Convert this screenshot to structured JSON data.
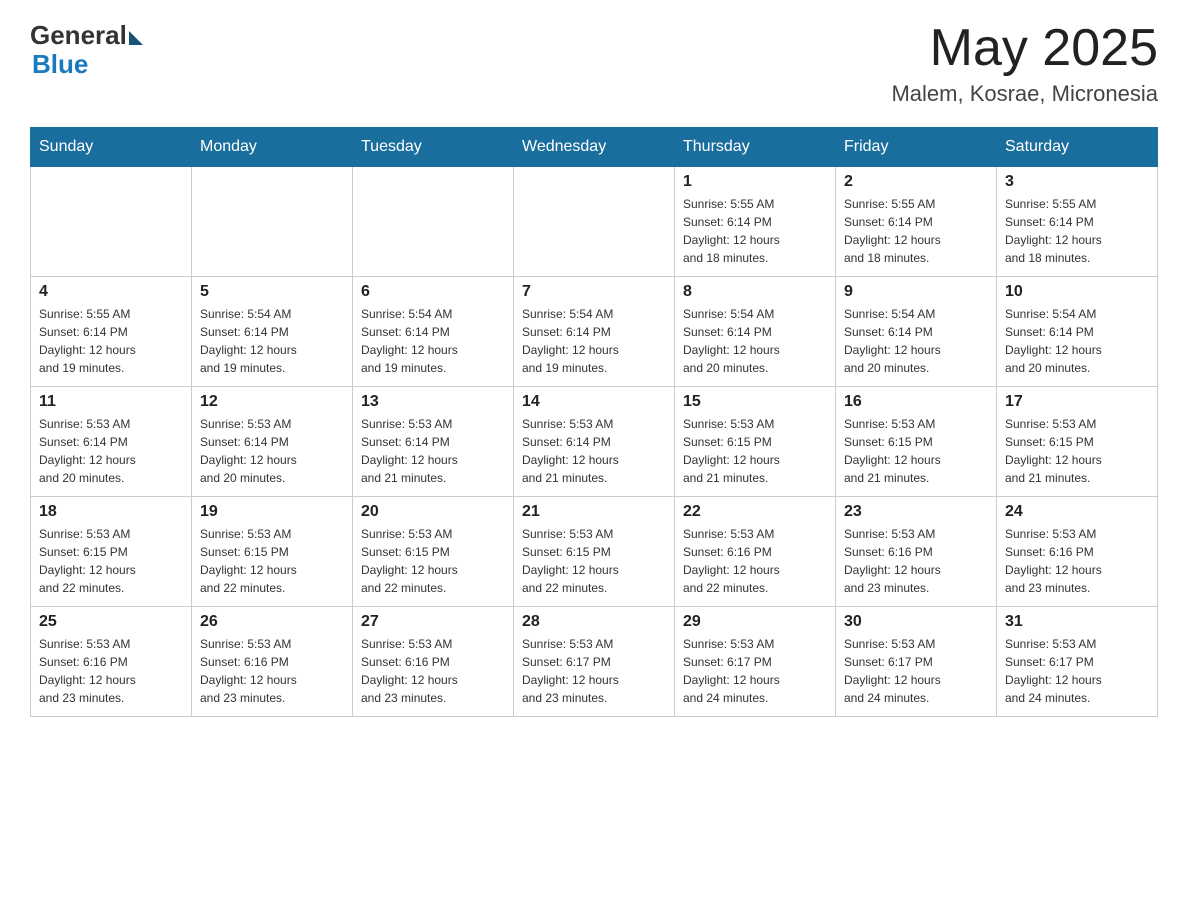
{
  "logo": {
    "text_general": "General",
    "text_blue": "Blue"
  },
  "header": {
    "month_year": "May 2025",
    "location": "Malem, Kosrae, Micronesia"
  },
  "days_of_week": [
    "Sunday",
    "Monday",
    "Tuesday",
    "Wednesday",
    "Thursday",
    "Friday",
    "Saturday"
  ],
  "weeks": [
    [
      {
        "day": "",
        "info": ""
      },
      {
        "day": "",
        "info": ""
      },
      {
        "day": "",
        "info": ""
      },
      {
        "day": "",
        "info": ""
      },
      {
        "day": "1",
        "info": "Sunrise: 5:55 AM\nSunset: 6:14 PM\nDaylight: 12 hours\nand 18 minutes."
      },
      {
        "day": "2",
        "info": "Sunrise: 5:55 AM\nSunset: 6:14 PM\nDaylight: 12 hours\nand 18 minutes."
      },
      {
        "day": "3",
        "info": "Sunrise: 5:55 AM\nSunset: 6:14 PM\nDaylight: 12 hours\nand 18 minutes."
      }
    ],
    [
      {
        "day": "4",
        "info": "Sunrise: 5:55 AM\nSunset: 6:14 PM\nDaylight: 12 hours\nand 19 minutes."
      },
      {
        "day": "5",
        "info": "Sunrise: 5:54 AM\nSunset: 6:14 PM\nDaylight: 12 hours\nand 19 minutes."
      },
      {
        "day": "6",
        "info": "Sunrise: 5:54 AM\nSunset: 6:14 PM\nDaylight: 12 hours\nand 19 minutes."
      },
      {
        "day": "7",
        "info": "Sunrise: 5:54 AM\nSunset: 6:14 PM\nDaylight: 12 hours\nand 19 minutes."
      },
      {
        "day": "8",
        "info": "Sunrise: 5:54 AM\nSunset: 6:14 PM\nDaylight: 12 hours\nand 20 minutes."
      },
      {
        "day": "9",
        "info": "Sunrise: 5:54 AM\nSunset: 6:14 PM\nDaylight: 12 hours\nand 20 minutes."
      },
      {
        "day": "10",
        "info": "Sunrise: 5:54 AM\nSunset: 6:14 PM\nDaylight: 12 hours\nand 20 minutes."
      }
    ],
    [
      {
        "day": "11",
        "info": "Sunrise: 5:53 AM\nSunset: 6:14 PM\nDaylight: 12 hours\nand 20 minutes."
      },
      {
        "day": "12",
        "info": "Sunrise: 5:53 AM\nSunset: 6:14 PM\nDaylight: 12 hours\nand 20 minutes."
      },
      {
        "day": "13",
        "info": "Sunrise: 5:53 AM\nSunset: 6:14 PM\nDaylight: 12 hours\nand 21 minutes."
      },
      {
        "day": "14",
        "info": "Sunrise: 5:53 AM\nSunset: 6:14 PM\nDaylight: 12 hours\nand 21 minutes."
      },
      {
        "day": "15",
        "info": "Sunrise: 5:53 AM\nSunset: 6:15 PM\nDaylight: 12 hours\nand 21 minutes."
      },
      {
        "day": "16",
        "info": "Sunrise: 5:53 AM\nSunset: 6:15 PM\nDaylight: 12 hours\nand 21 minutes."
      },
      {
        "day": "17",
        "info": "Sunrise: 5:53 AM\nSunset: 6:15 PM\nDaylight: 12 hours\nand 21 minutes."
      }
    ],
    [
      {
        "day": "18",
        "info": "Sunrise: 5:53 AM\nSunset: 6:15 PM\nDaylight: 12 hours\nand 22 minutes."
      },
      {
        "day": "19",
        "info": "Sunrise: 5:53 AM\nSunset: 6:15 PM\nDaylight: 12 hours\nand 22 minutes."
      },
      {
        "day": "20",
        "info": "Sunrise: 5:53 AM\nSunset: 6:15 PM\nDaylight: 12 hours\nand 22 minutes."
      },
      {
        "day": "21",
        "info": "Sunrise: 5:53 AM\nSunset: 6:15 PM\nDaylight: 12 hours\nand 22 minutes."
      },
      {
        "day": "22",
        "info": "Sunrise: 5:53 AM\nSunset: 6:16 PM\nDaylight: 12 hours\nand 22 minutes."
      },
      {
        "day": "23",
        "info": "Sunrise: 5:53 AM\nSunset: 6:16 PM\nDaylight: 12 hours\nand 23 minutes."
      },
      {
        "day": "24",
        "info": "Sunrise: 5:53 AM\nSunset: 6:16 PM\nDaylight: 12 hours\nand 23 minutes."
      }
    ],
    [
      {
        "day": "25",
        "info": "Sunrise: 5:53 AM\nSunset: 6:16 PM\nDaylight: 12 hours\nand 23 minutes."
      },
      {
        "day": "26",
        "info": "Sunrise: 5:53 AM\nSunset: 6:16 PM\nDaylight: 12 hours\nand 23 minutes."
      },
      {
        "day": "27",
        "info": "Sunrise: 5:53 AM\nSunset: 6:16 PM\nDaylight: 12 hours\nand 23 minutes."
      },
      {
        "day": "28",
        "info": "Sunrise: 5:53 AM\nSunset: 6:17 PM\nDaylight: 12 hours\nand 23 minutes."
      },
      {
        "day": "29",
        "info": "Sunrise: 5:53 AM\nSunset: 6:17 PM\nDaylight: 12 hours\nand 24 minutes."
      },
      {
        "day": "30",
        "info": "Sunrise: 5:53 AM\nSunset: 6:17 PM\nDaylight: 12 hours\nand 24 minutes."
      },
      {
        "day": "31",
        "info": "Sunrise: 5:53 AM\nSunset: 6:17 PM\nDaylight: 12 hours\nand 24 minutes."
      }
    ]
  ]
}
